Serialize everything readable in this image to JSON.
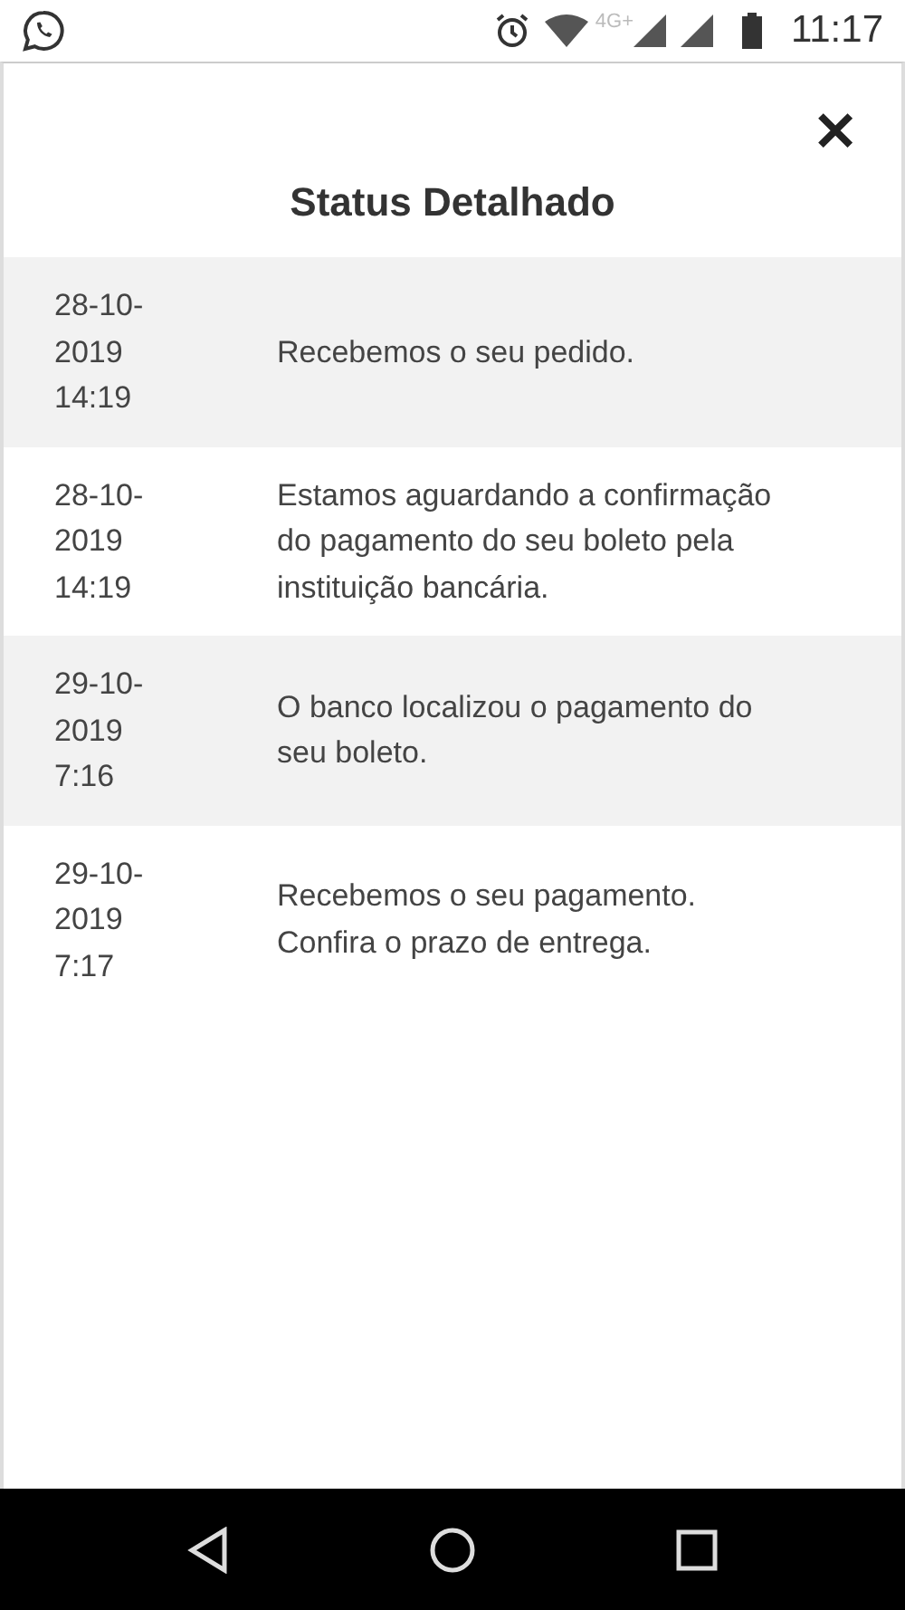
{
  "status_bar": {
    "time": "11:17",
    "network": "4G+"
  },
  "dialog": {
    "title": "Status Detalhado",
    "close": "✕"
  },
  "entries": [
    {
      "date": "28-10-2019 14:19",
      "message": "Recebemos o seu pedido."
    },
    {
      "date": "28-10-2019 14:19",
      "message": "Estamos aguardando a confirmação do pagamento do seu boleto pela instituição bancária."
    },
    {
      "date": "29-10-2019 7:16",
      "message": "O banco localizou o pagamento do seu boleto."
    },
    {
      "date": "29-10-2019 7:17",
      "message": "Recebemos o seu pagamento. Confira o prazo de entrega."
    }
  ]
}
